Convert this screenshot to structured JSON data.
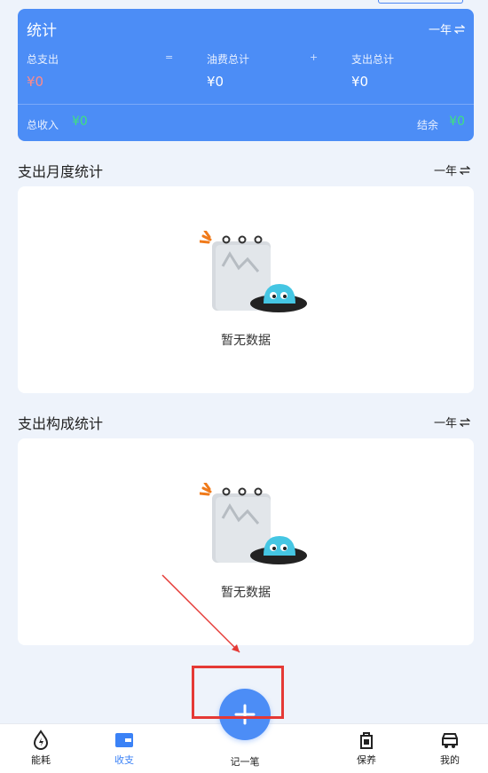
{
  "stats": {
    "title": "统计",
    "period": "一年",
    "total_expense_label": "总支出",
    "total_expense_value": "¥0",
    "equals": "=",
    "fuel_total_label": "油费总计",
    "fuel_total_value": "¥0",
    "plus": "+",
    "other_total_label": "支出总计",
    "other_total_value": "¥0",
    "income_label": "总收入",
    "income_value": "¥0",
    "balance_label": "结余",
    "balance_value": "¥0"
  },
  "monthly_section": {
    "title": "支出月度统计",
    "period": "一年",
    "empty_text": "暂无数据"
  },
  "composition_section": {
    "title": "支出构成统计",
    "period": "一年",
    "empty_text": "暂无数据"
  },
  "bottom_nav": {
    "energy": "能耗",
    "income_expense": "收支",
    "add_record": "记一笔",
    "maintenance": "保养",
    "mine": "我的"
  },
  "colors": {
    "accent": "#4c8df6",
    "income_green": "#3fe17f",
    "expense_red": "#ff8a8a",
    "annotation_red": "#e53935"
  }
}
